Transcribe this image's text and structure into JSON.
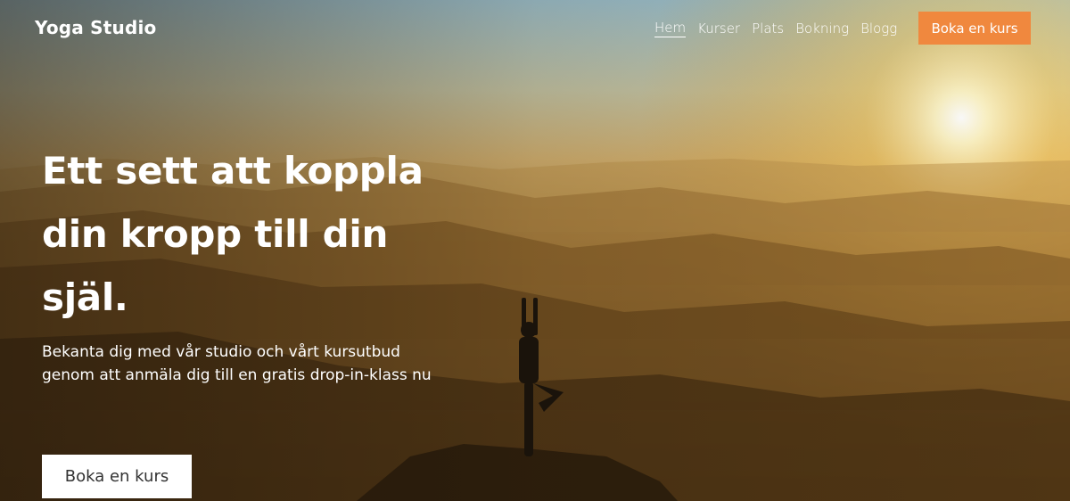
{
  "brand": {
    "name": "Yoga Studio"
  },
  "nav": {
    "items": [
      {
        "label": "Hem",
        "active": true
      },
      {
        "label": "Kurser",
        "active": false
      },
      {
        "label": "Plats",
        "active": false
      },
      {
        "label": "Bokning",
        "active": false
      },
      {
        "label": "Blogg",
        "active": false
      }
    ],
    "cta_label": "Boka en kurs"
  },
  "hero": {
    "headline": "Ett sett att koppla din kropp till din själ.",
    "subtitle": "Bekanta dig med vår studio och vårt kursutbud genom att anmäla dig till en gratis drop-in-klass nu",
    "cta_label": "Boka en kurs"
  },
  "colors": {
    "accent": "#f0883e",
    "text_on_image": "#ffffff",
    "hero_button_bg": "#ffffff"
  }
}
